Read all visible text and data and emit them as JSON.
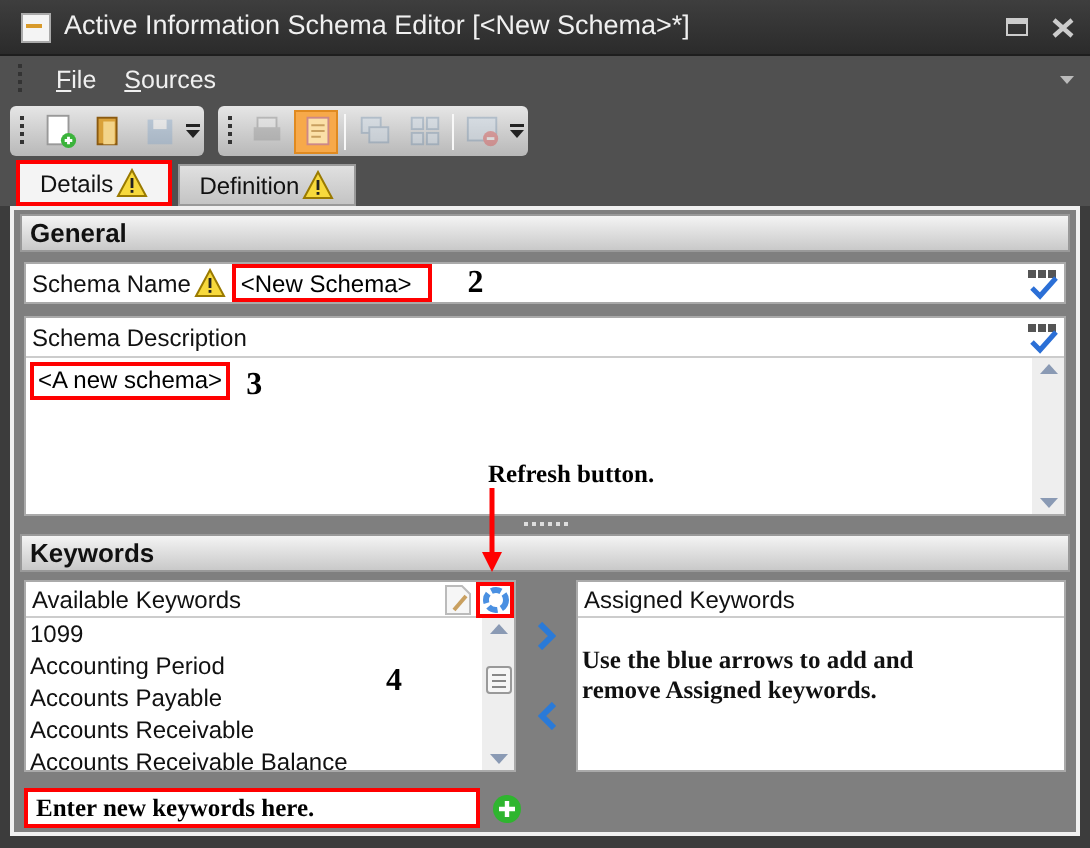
{
  "window": {
    "title": "Active Information Schema Editor [<New Schema>*]"
  },
  "menu": [
    {
      "label": "File"
    },
    {
      "label": "Sources"
    }
  ],
  "toolbars": [
    {
      "buttons": [
        {
          "kind": "new",
          "disabled": false,
          "selected": false
        },
        {
          "kind": "open",
          "disabled": false,
          "selected": false
        },
        {
          "kind": "save",
          "disabled": true,
          "selected": false
        }
      ]
    },
    {
      "buttons": [
        {
          "kind": "print",
          "disabled": true,
          "selected": false
        },
        {
          "kind": "note",
          "disabled": false,
          "selected": true
        },
        {
          "kind": "separator"
        },
        {
          "kind": "cascade",
          "disabled": true,
          "selected": false
        },
        {
          "kind": "tile",
          "disabled": true,
          "selected": false
        },
        {
          "kind": "separator"
        },
        {
          "kind": "close",
          "disabled": true,
          "selected": false
        }
      ]
    }
  ],
  "tabs": [
    {
      "label": "Details",
      "selected": true,
      "warning": true,
      "highlighted": true
    },
    {
      "label": "Definition",
      "selected": false,
      "warning": true,
      "highlighted": false
    }
  ],
  "general": {
    "title": "General",
    "schema_name": {
      "label": "Schema Name",
      "warning": true,
      "value": "<New Schema>",
      "highlighted": true,
      "callout": "2"
    },
    "description": {
      "label": "Schema Description",
      "value": "<A new schema>",
      "highlighted": true,
      "callout": "3"
    }
  },
  "keywords": {
    "title": "Keywords",
    "available": {
      "label": "Available Keywords",
      "callout": "4",
      "items": [
        "1099",
        "Accounting Period",
        "Accounts Payable",
        "Accounts Receivable",
        "Accounts Receivable Balance"
      ]
    },
    "refresh_button": {
      "highlighted": true,
      "callout": "Refresh button."
    },
    "assigned": {
      "label": "Assigned Keywords",
      "note": "Use the blue arrows to add and remove Assigned keywords."
    },
    "new_keyword": {
      "note": "Enter new keywords here.",
      "highlighted": true
    }
  }
}
